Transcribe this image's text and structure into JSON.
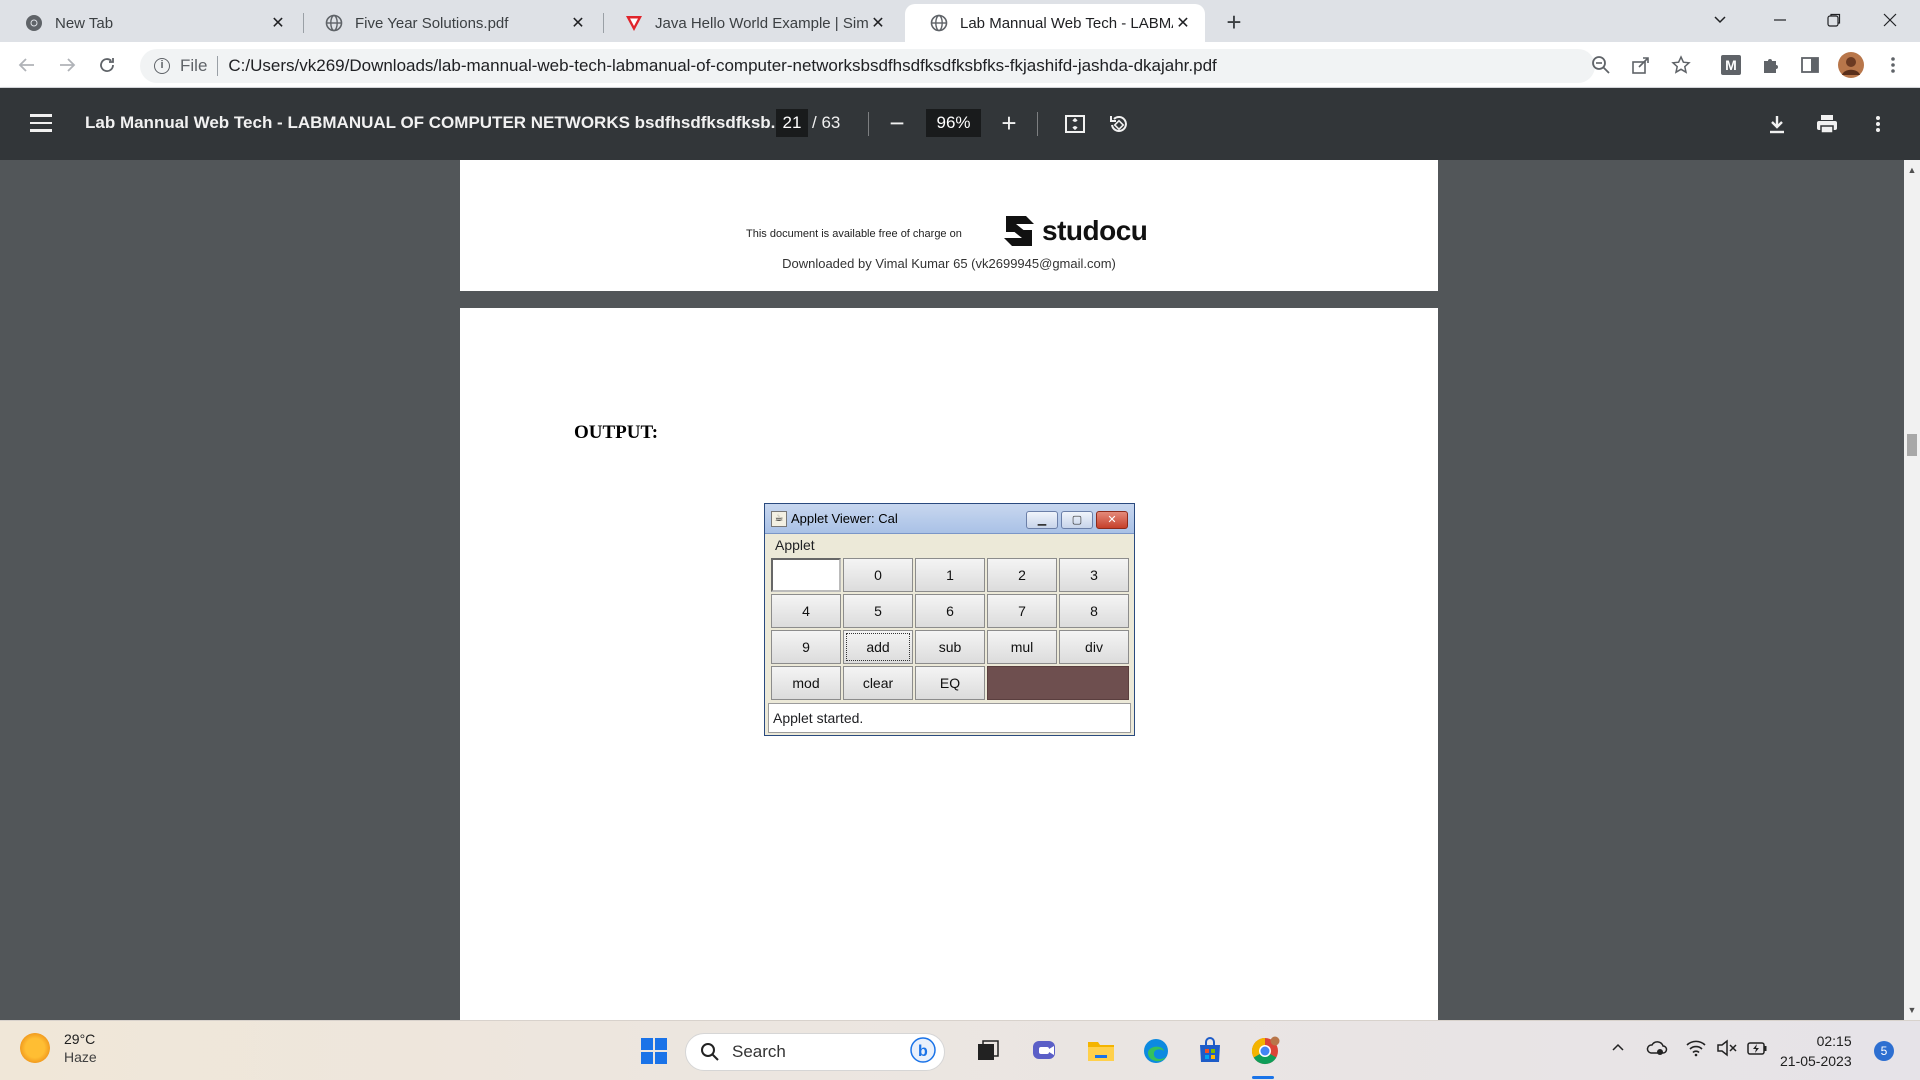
{
  "browser": {
    "tabs": [
      {
        "title": "New Tab",
        "active": false,
        "icon": "chrome-icon"
      },
      {
        "title": "Five Year Solutions.pdf",
        "active": false,
        "icon": "globe-icon"
      },
      {
        "title": "Java Hello World Example | Simpl",
        "active": false,
        "icon": "v-logo-icon"
      },
      {
        "title": "Lab Mannual Web Tech - LABMA",
        "active": true,
        "icon": "globe-icon"
      }
    ],
    "address": {
      "scheme_label": "File",
      "url": "C:/Users/vk269/Downloads/lab-mannual-web-tech-labmanual-of-computer-networksbsdfhsdfksdfksbfks-fkjashifd-jashda-dkajahr.pdf"
    },
    "extension_letter": "M"
  },
  "pdf_viewer": {
    "title": "Lab Mannual Web Tech - LABMANUAL OF COMPUTER NETWORKS bsdfhsdfksdfksb...",
    "current_page": "21",
    "total_pages": "/ 63",
    "zoom": "96%"
  },
  "document": {
    "footer_text": "This document is available free of charge on",
    "brand": "studocu",
    "downloaded_by": "Downloaded by Vimal Kumar 65 (vk2699945@gmail.com)",
    "output_heading": "OUTPUT:",
    "applet": {
      "window_title": "Applet Viewer: Cal",
      "menu": "Applet",
      "buttons": [
        "0",
        "1",
        "2",
        "3",
        "4",
        "5",
        "6",
        "7",
        "8",
        "9",
        "add",
        "sub",
        "mul",
        "div",
        "mod",
        "clear",
        "EQ"
      ],
      "status": "Applet started."
    }
  },
  "taskbar": {
    "weather_temp": "29°C",
    "weather_condition": "Haze",
    "search_placeholder": "Search",
    "time": "02:15",
    "date": "21-05-2023",
    "notification_count": "5"
  }
}
